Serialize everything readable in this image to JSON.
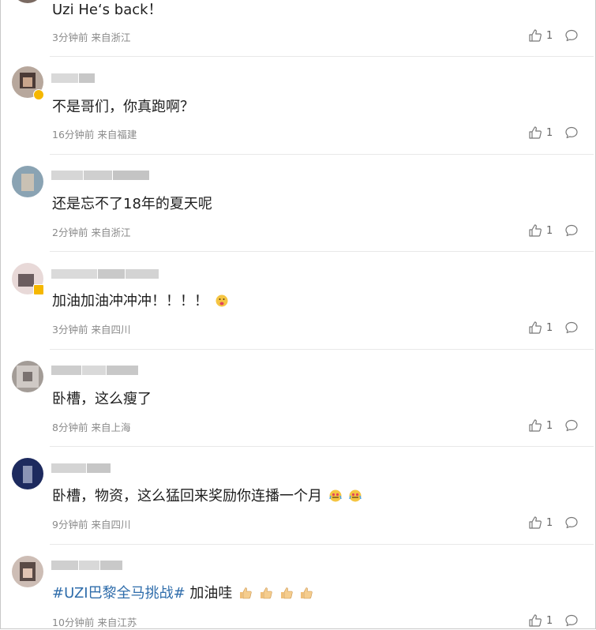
{
  "comments": [
    {
      "text": "Uzi He‘s back！",
      "time": "3分钟前",
      "source": "来自浙江",
      "likes": "1"
    },
    {
      "text": "不是哥们，你真跑啊？",
      "time": "16分钟前",
      "source": "来自福建",
      "likes": "1"
    },
    {
      "text": "还是忘不了18年的夏天呢",
      "time": "2分钟前",
      "source": "来自浙江",
      "likes": "1"
    },
    {
      "text": "加油加油冲冲冲！！！！",
      "time": "3分钟前",
      "source": "来自四川",
      "likes": "1"
    },
    {
      "text": "卧槽，这么瘦了",
      "time": "8分钟前",
      "source": "来自上海",
      "likes": "1"
    },
    {
      "text": "卧槽，物资，这么猛回来奖励你连播一个月",
      "time": "9分钟前",
      "source": "来自四川",
      "likes": "1"
    },
    {
      "topic": "#UZI巴黎全马挑战#",
      "text": " 加油哇",
      "time": "10分钟前",
      "source": "来自江苏",
      "likes": "1"
    }
  ],
  "icons": {
    "like": "thumbs-up-icon",
    "reply": "comment-bubble-icon",
    "verified": "verified-badge-icon"
  },
  "colors": {
    "topic": "#2f6dab",
    "meta": "#8a8a8a",
    "badge": "#f5b700"
  }
}
